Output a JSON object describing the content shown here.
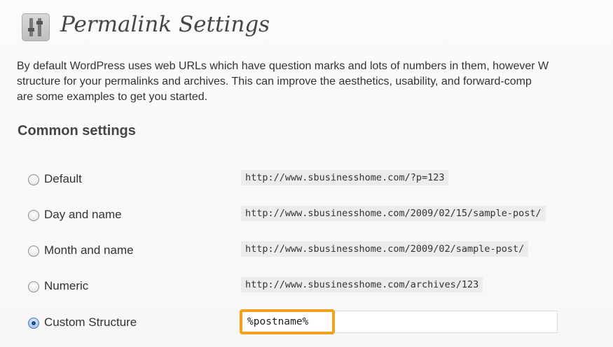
{
  "header": {
    "title": "Permalink Settings",
    "icon": "settings-sliders-icon"
  },
  "description": {
    "lines": [
      "By default WordPress uses web URLs which have question marks and lots of numbers in them, however W",
      "structure for your permalinks and archives. This can improve the aesthetics, usability, and forward-comp",
      "are some examples to get you started."
    ]
  },
  "common_settings": {
    "heading": "Common settings",
    "options": [
      {
        "label": "Default",
        "example": "http://www.sbusinesshome.com/?p=123",
        "checked": false
      },
      {
        "label": "Day and name",
        "example": "http://www.sbusinesshome.com/2009/02/15/sample-post/",
        "checked": false
      },
      {
        "label": "Month and name",
        "example": "http://www.sbusinesshome.com/2009/02/sample-post/",
        "checked": false
      },
      {
        "label": "Numeric",
        "example": "http://www.sbusinesshome.com/archives/123",
        "checked": false
      },
      {
        "label": "Custom Structure",
        "value": "%postname%",
        "checked": true
      }
    ]
  },
  "colors": {
    "highlight": "#f0a21d",
    "code_background": "#ececec"
  }
}
